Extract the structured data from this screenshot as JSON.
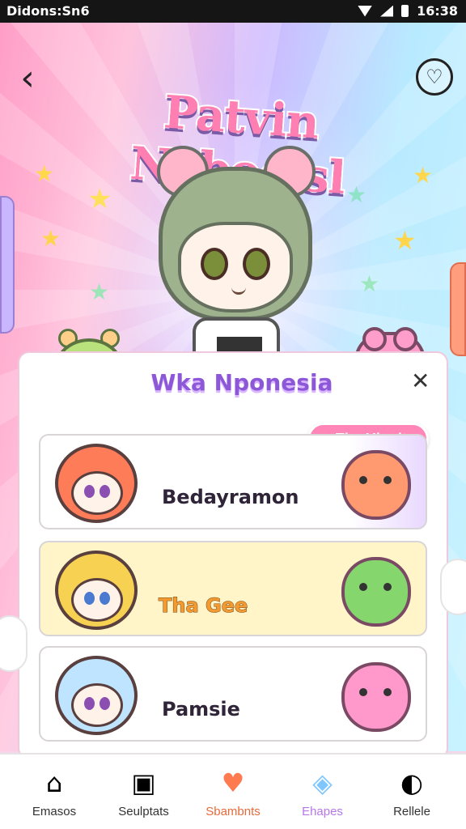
{
  "status": {
    "carrier": "Didons:Sn6",
    "time": "16:38"
  },
  "header": {
    "title": "Patvin Naboeisl",
    "back_icon": "chevron-left-icon",
    "favorite_icon": "heart-icon"
  },
  "panel": {
    "title": "Wka Nponesia",
    "close_icon": "close-icon",
    "pill_label": "The Ulonits",
    "pill_icon": "heart-icon",
    "cards": [
      {
        "label": "Bedayramon",
        "accent": "#ff8c58"
      },
      {
        "label": "Tha Gee",
        "accent": "#f3c33c"
      },
      {
        "label": "Pamsie",
        "accent": "#bfe4ff"
      }
    ]
  },
  "bottom_nav": [
    {
      "label": "Emasos",
      "icon": "home-icon"
    },
    {
      "label": "Seulptats",
      "icon": "album-icon"
    },
    {
      "label": "Sbambnts",
      "icon": "heart-icon"
    },
    {
      "label": "Ehapes",
      "icon": "gift-icon"
    },
    {
      "label": "Rellele",
      "icon": "compass-icon"
    }
  ],
  "colors": {
    "pink": "#ff86b6",
    "purple": "#8d58d8",
    "orange": "#e86a3c"
  }
}
